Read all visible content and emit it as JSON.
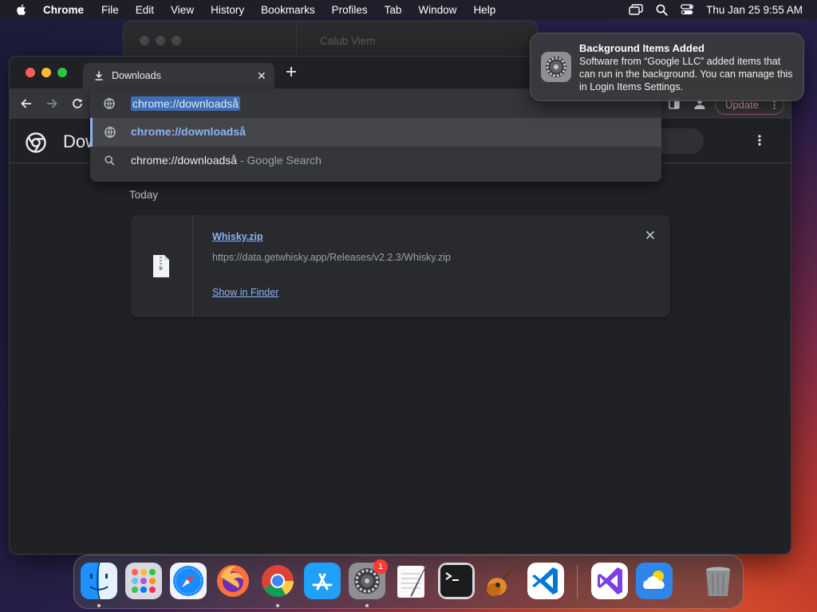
{
  "menubar": {
    "app_name": "Chrome",
    "items": [
      "File",
      "Edit",
      "View",
      "History",
      "Bookmarks",
      "Profiles",
      "Tab",
      "Window",
      "Help"
    ],
    "clock": "Thu Jan 25  9:55 AM"
  },
  "back_window": {
    "title": "Calub Viem"
  },
  "browser": {
    "tab_title": "Downloads",
    "new_tab_label": "+",
    "tab_close_label": "✕",
    "update_label": "Update"
  },
  "omnibox": {
    "input_value": "chrome://downloadså",
    "suggestions": [
      {
        "text": "chrome://downloadså",
        "suffix": "",
        "icon": "globe-icon"
      },
      {
        "text": "chrome://downloadså",
        "suffix": " - Google Search",
        "icon": "search-icon"
      }
    ]
  },
  "page": {
    "title": "Downloads",
    "date_group": "Today",
    "download": {
      "file_name": "Whisky.zip",
      "url": "https://data.getwhisky.app/Releases/v2.2.3/Whisky.zip",
      "action": "Show in Finder"
    }
  },
  "notification": {
    "title": "Background Items Added",
    "body": "Software from “Google LLC” added items that can run in the background. You can manage this in Login Items Settings."
  },
  "dock": {
    "apps": [
      "Finder",
      "Launchpad",
      "Safari",
      "Firefox",
      "Google Chrome",
      "App Store",
      "System Settings",
      "TextEdit",
      "Terminal",
      "GarageBand",
      "Visual Studio Code",
      "Visual Studio",
      "Weather",
      "Trash"
    ],
    "settings_badge": "1"
  },
  "colors": {
    "accent_blue": "#8ab4f8",
    "window_bg": "#202124",
    "toolbar_bg": "#35363a",
    "update_text": "#e8a59e",
    "badge_red": "#ff3b30"
  }
}
